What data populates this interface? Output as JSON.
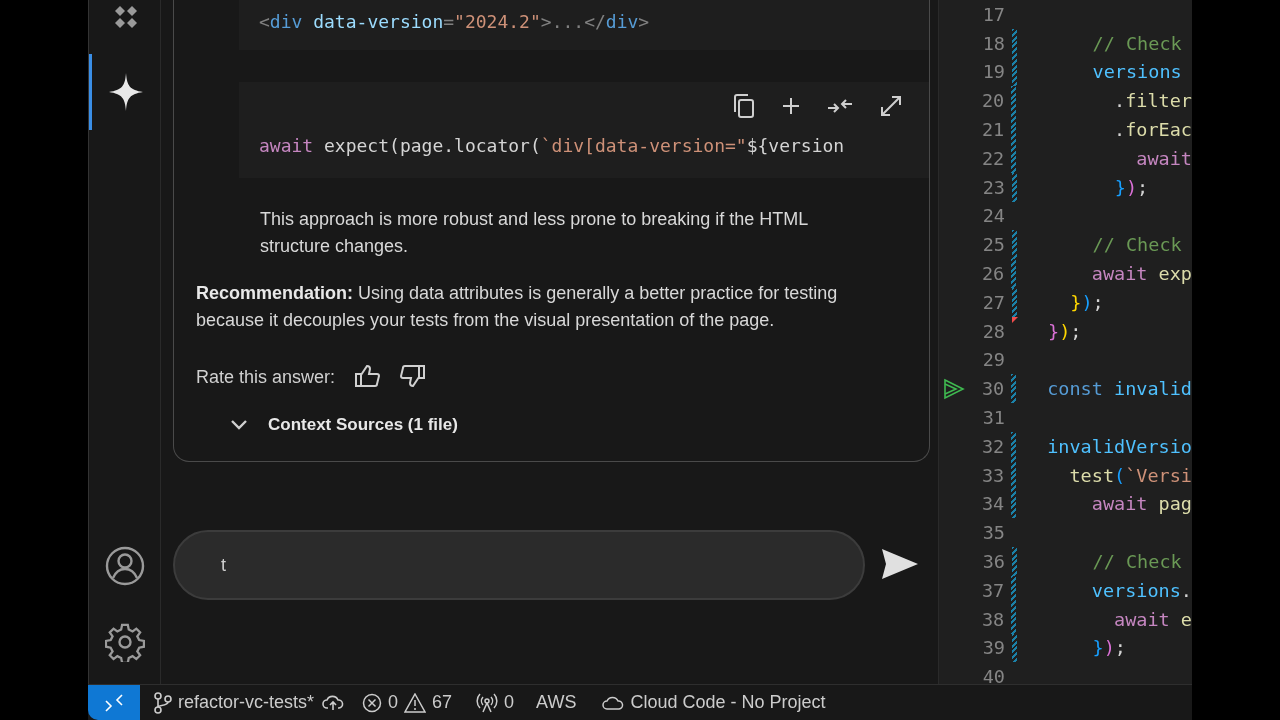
{
  "activity_bar": {
    "items": [
      {
        "kind": "extensions",
        "selected": false
      },
      {
        "kind": "assistant",
        "selected": true
      }
    ]
  },
  "chat": {
    "snippet_top": {
      "lines": [
        [
          {
            "text": "<",
            "kind": "punct"
          },
          {
            "text": "div",
            "kind": "tag"
          },
          {
            "text": " data-version",
            "kind": "attr"
          },
          {
            "text": "=",
            "kind": "punct"
          },
          {
            "text": "\"2024.2\"",
            "kind": "string"
          },
          {
            "text": ">...</",
            "kind": "punct"
          },
          {
            "text": "div",
            "kind": "tag"
          },
          {
            "text": ">",
            "kind": "punct"
          }
        ]
      ]
    },
    "snippet_code": {
      "lines": [
        [
          {
            "text": "await",
            "kind": "keyword"
          },
          {
            "text": " expect(page.locator(",
            "kind": "plain"
          },
          {
            "text": "`div[data-version=\"",
            "kind": "string"
          },
          {
            "text": "${version",
            "kind": "plain"
          }
        ]
      ]
    },
    "note": "This approach is more robust and less prone to breaking if the HTML structure changes.",
    "recommendation": "**Recommendation:** Using data attributes is generally a better practice for testing because it decouples your tests from the visual presentation of the page.",
    "rate_label": "Rate this answer:",
    "context_sources": {
      "label": "Context Sources (1 file)",
      "expanded": false
    },
    "input": {
      "value": "t"
    }
  },
  "editor": {
    "lines": [
      {
        "number": "17",
        "modified": false,
        "deleted": false,
        "run_button": false
      },
      {
        "number": "18",
        "modified": true,
        "deleted": false,
        "run_button": false,
        "tokens": [
          {
            "text": "    // Check",
            "kind": "comment"
          }
        ]
      },
      {
        "number": "19",
        "modified": true,
        "deleted": false,
        "run_button": false,
        "tokens": [
          {
            "text": "    versions",
            "kind": "variable"
          }
        ]
      },
      {
        "number": "20",
        "modified": true,
        "deleted": false,
        "run_button": false,
        "tokens": [
          {
            "text": "      .",
            "kind": "plain"
          },
          {
            "text": "filter",
            "kind": "function"
          }
        ]
      },
      {
        "number": "21",
        "modified": true,
        "deleted": false,
        "run_button": false,
        "tokens": [
          {
            "text": "      .",
            "kind": "plain"
          },
          {
            "text": "forEac",
            "kind": "function"
          }
        ]
      },
      {
        "number": "22",
        "modified": true,
        "deleted": false,
        "run_button": false,
        "tokens": [
          {
            "text": "        await",
            "kind": "keyword"
          }
        ]
      },
      {
        "number": "23",
        "modified": true,
        "deleted": false,
        "run_button": false,
        "tokens": [
          {
            "text": "      }",
            "kind": "bracket_blue"
          },
          {
            "text": ")",
            "kind": "bracket_purple"
          },
          {
            "text": ";",
            "kind": "plain"
          }
        ]
      },
      {
        "number": "24",
        "modified": false,
        "deleted": false,
        "run_button": false
      },
      {
        "number": "25",
        "modified": true,
        "deleted": false,
        "run_button": false,
        "tokens": [
          {
            "text": "    // Check",
            "kind": "comment"
          }
        ]
      },
      {
        "number": "26",
        "modified": true,
        "deleted": false,
        "run_button": false,
        "tokens": [
          {
            "text": "    await",
            "kind": "keyword"
          },
          {
            "text": " exp",
            "kind": "function"
          }
        ]
      },
      {
        "number": "27",
        "modified": true,
        "deleted": false,
        "run_button": false,
        "tokens": [
          {
            "text": "  }",
            "kind": "bracket_yellow"
          },
          {
            "text": ")",
            "kind": "bracket_blue"
          },
          {
            "text": ";",
            "kind": "plain"
          }
        ]
      },
      {
        "number": "28",
        "modified": false,
        "deleted": true,
        "run_button": false,
        "tokens": [
          {
            "text": "}",
            "kind": "bracket_purple"
          },
          {
            "text": ")",
            "kind": "bracket_yellow"
          },
          {
            "text": ";",
            "kind": "plain"
          }
        ]
      },
      {
        "number": "29",
        "modified": false,
        "deleted": false,
        "run_button": false
      },
      {
        "number": "30",
        "modified": true,
        "deleted": false,
        "run_button": true,
        "tokens": [
          {
            "text": "const",
            "kind": "storage"
          },
          {
            "text": " invalid",
            "kind": "variable"
          }
        ]
      },
      {
        "number": "31",
        "modified": false,
        "deleted": false,
        "run_button": false
      },
      {
        "number": "32",
        "modified": true,
        "deleted": false,
        "run_button": false,
        "tokens": [
          {
            "text": "invalidVersio",
            "kind": "variable"
          }
        ]
      },
      {
        "number": "33",
        "modified": true,
        "deleted": false,
        "run_button": false,
        "tokens": [
          {
            "text": "  test",
            "kind": "function"
          },
          {
            "text": "(",
            "kind": "bracket_blue"
          },
          {
            "text": "`Versi",
            "kind": "string"
          }
        ]
      },
      {
        "number": "34",
        "modified": true,
        "deleted": false,
        "run_button": false,
        "tokens": [
          {
            "text": "    await",
            "kind": "keyword"
          },
          {
            "text": " pag",
            "kind": "function"
          }
        ]
      },
      {
        "number": "35",
        "modified": false,
        "deleted": false,
        "run_button": false
      },
      {
        "number": "36",
        "modified": true,
        "deleted": false,
        "run_button": false,
        "tokens": [
          {
            "text": "    // Check",
            "kind": "comment"
          }
        ]
      },
      {
        "number": "37",
        "modified": true,
        "deleted": false,
        "run_button": false,
        "tokens": [
          {
            "text": "    versions",
            "kind": "variable"
          },
          {
            "text": ".",
            "kind": "plain"
          }
        ]
      },
      {
        "number": "38",
        "modified": true,
        "deleted": false,
        "run_button": false,
        "tokens": [
          {
            "text": "      await",
            "kind": "keyword"
          },
          {
            "text": " e",
            "kind": "function"
          }
        ]
      },
      {
        "number": "39",
        "modified": true,
        "deleted": false,
        "run_button": false,
        "tokens": [
          {
            "text": "    }",
            "kind": "bracket_blue"
          },
          {
            "text": ")",
            "kind": "bracket_purple"
          },
          {
            "text": ";",
            "kind": "plain"
          }
        ]
      },
      {
        "number": "40",
        "modified": false,
        "deleted": false,
        "run_button": false
      }
    ]
  },
  "status_bar": {
    "branch": "refactor-vc-tests*",
    "errors": "0",
    "warnings": "67",
    "ports": "0",
    "aws": "AWS",
    "cloud_code": "Cloud Code - No Project"
  }
}
